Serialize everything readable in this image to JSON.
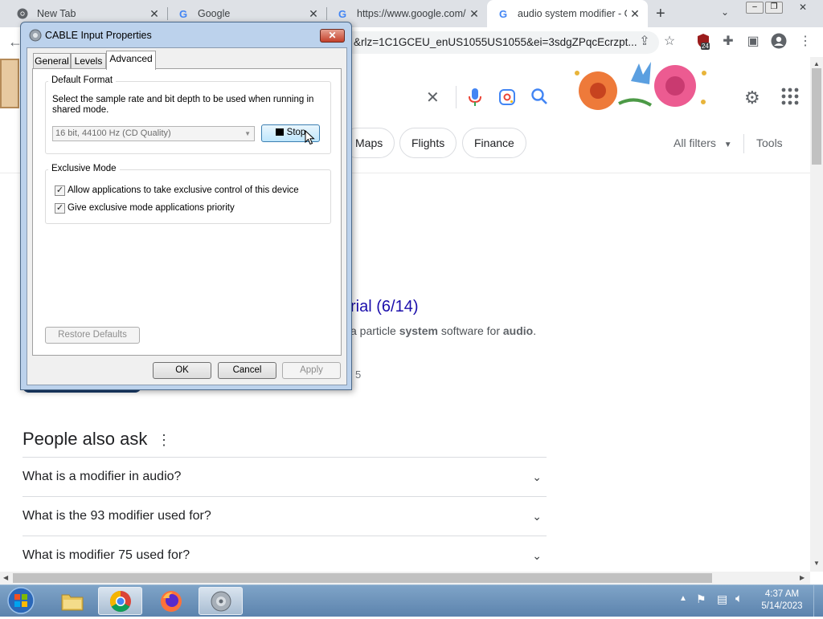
{
  "browser": {
    "tabs": [
      {
        "label": "New Tab",
        "icon": "chrome-icon"
      },
      {
        "label": "Google",
        "icon": "google-g-icon"
      },
      {
        "label": "https://www.google.com/",
        "icon": "google-g-icon"
      },
      {
        "label": "audio system modifier - G",
        "icon": "google-g-icon",
        "active": true
      }
    ],
    "new_tab_symbol": "+",
    "address": "&rlz=1C1GCEU_enUS1055US1055&ei=3sdgZPqcEcrzpt...",
    "extension_badge": "24"
  },
  "google": {
    "filter_chips": [
      "Maps",
      "Flights",
      "Finance"
    ],
    "all_filters_label": "All filters",
    "tools_label": "Tools",
    "result_title_fragment": "rial (6/14)",
    "result_snippet": {
      "pre": "a particle ",
      "b1": "system",
      "mid": " software for ",
      "b2": "audio",
      "post": "."
    },
    "result_extra": "5",
    "paa_heading": "People also ask",
    "paa_questions": [
      "What is a modifier in audio?",
      "What is the 93 modifier used for?",
      "What is modifier 75 used for?"
    ]
  },
  "dialog": {
    "title": "CABLE Input Properties",
    "close_symbol": "✕",
    "tabs": [
      "General",
      "Levels",
      "Advanced"
    ],
    "default_format": {
      "heading": "Default Format",
      "description": "Select the sample rate and bit depth to be used when running in shared mode.",
      "selected_format": "16 bit, 44100 Hz (CD Quality)",
      "stop_label": "Stop"
    },
    "exclusive_mode": {
      "heading": "Exclusive Mode",
      "option1": "Allow applications to take exclusive control of this device",
      "option2": "Give exclusive mode applications priority",
      "check1": "✓",
      "check2": "✓"
    },
    "restore_defaults_label": "Restore Defaults",
    "ok_label": "OK",
    "cancel_label": "Cancel",
    "apply_label": "Apply"
  },
  "taskbar": {
    "time": "4:37 AM",
    "date": "5/14/2023"
  },
  "colors": {
    "google_blue": "#1a0dab",
    "taskbar": "#5c83ad",
    "dialog_frame": "#bcd2ec"
  }
}
